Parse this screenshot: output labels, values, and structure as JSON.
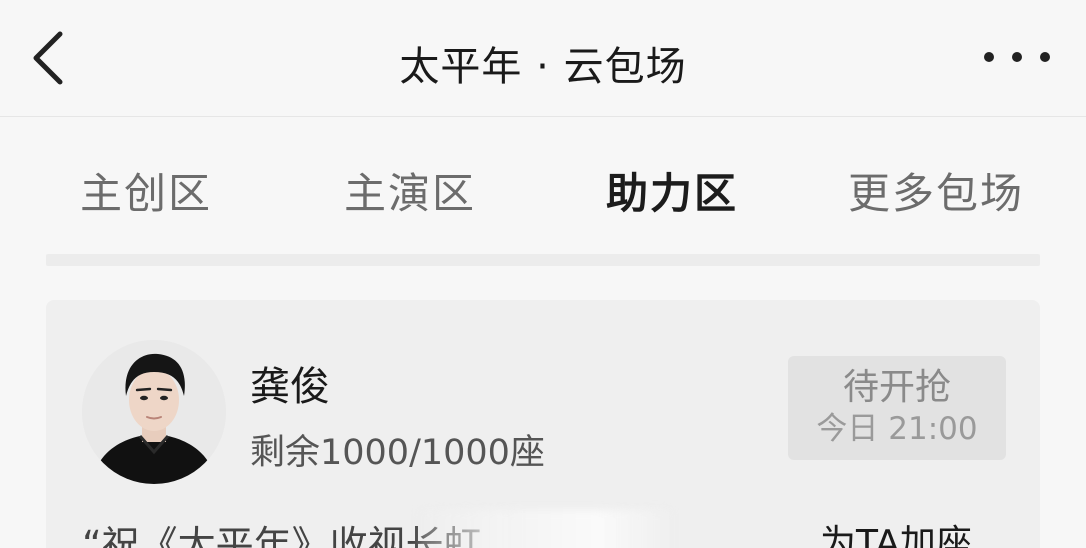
{
  "header": {
    "title": "太平年 · 云包场",
    "back_icon": "chevron-left-icon",
    "more_icon": "ellipsis-icon"
  },
  "tabs": [
    {
      "label": "主创区",
      "active": false
    },
    {
      "label": "主演区",
      "active": false
    },
    {
      "label": "助力区",
      "active": true
    },
    {
      "label": "更多包场",
      "active": false
    }
  ],
  "card": {
    "name": "龚俊",
    "seats": "剩余1000/1000座",
    "status": {
      "label": "待开抢",
      "time": "今日 21:00"
    },
    "quote": "“祝《太平年》收视长虹",
    "action": "为TA加座"
  },
  "colors": {
    "background": "#f7f7f7",
    "card": "#efefef",
    "status_bg": "#e2e2e2",
    "active_tab": "#1c1c1c",
    "inactive_tab": "#6c6c6c"
  }
}
